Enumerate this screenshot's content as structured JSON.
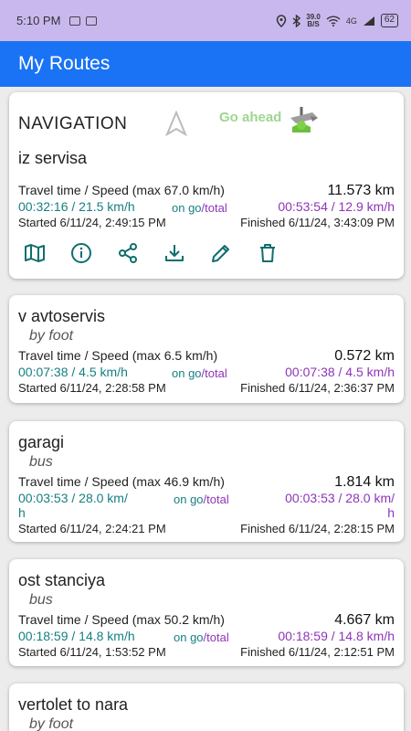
{
  "status_bar": {
    "time": "5:10 PM",
    "net_speed_value": "39.0",
    "net_speed_unit": "B/S",
    "network": "4G",
    "battery": "62"
  },
  "app_bar": {
    "title": "My Routes"
  },
  "navigation_card": {
    "header": "NAVIGATION",
    "go_ahead": "Go ahead",
    "name": "iz servisa",
    "travel_label": "Travel time / Speed (max 67.0 km/h)",
    "distance": "11.573 km",
    "on_go_value": "00:32:16 / 21.5 km/h",
    "on_go_label": "on go",
    "slash": "/",
    "total_label": "total",
    "total_value": "00:53:54 / 12.9 km/h",
    "started": "Started 6/11/24, 2:49:15 PM",
    "finished": "Finished 6/11/24, 3:43:09 PM",
    "actions": [
      "map-icon",
      "info-icon",
      "share-icon",
      "download-icon",
      "edit-icon",
      "delete-icon"
    ]
  },
  "routes": [
    {
      "name": "v avtoservis",
      "mode": "by foot",
      "travel_label": "Travel time / Speed (max 6.5 km/h)",
      "distance": "0.572 km",
      "on_go_value": "00:07:38 / 4.5 km/h",
      "on_go_label": "on go",
      "slash": "/",
      "total_label": "total",
      "total_value": "00:07:38 / 4.5 km/h",
      "started": "Started 6/11/24, 2:28:58 PM",
      "finished": "Finished 6/11/24, 2:36:37 PM"
    },
    {
      "name": "garagi",
      "mode": "bus",
      "travel_label": "Travel time / Speed (max 46.9 km/h)",
      "distance": "1.814 km",
      "on_go_value": "00:03:53 / 28.0 km/",
      "on_go_value_wrap": "h",
      "on_go_label": "on go",
      "slash": "/",
      "total_label": "total",
      "total_value": "00:03:53 / 28.0 km/",
      "total_value_wrap": "h",
      "started": "Started 6/11/24, 2:24:21 PM",
      "finished": "Finished 6/11/24, 2:28:15 PM"
    },
    {
      "name": "ost stanciya",
      "mode": "bus",
      "travel_label": "Travel time / Speed (max 50.2 km/h)",
      "distance": "4.667 km",
      "on_go_value": "00:18:59 / 14.8 km/h",
      "on_go_label": "on go",
      "slash": "/",
      "total_label": "total",
      "total_value": "00:18:59 / 14.8 km/h",
      "started": "Started 6/11/24, 1:53:52 PM",
      "finished": "Finished 6/11/24, 2:12:51 PM"
    },
    {
      "name": "vertolet to nara",
      "mode": "by foot"
    }
  ],
  "colors": {
    "accent": "#1a73f5",
    "status_bar": "#c9b8ee",
    "on_go": "#167f82",
    "total": "#8e35b8"
  }
}
